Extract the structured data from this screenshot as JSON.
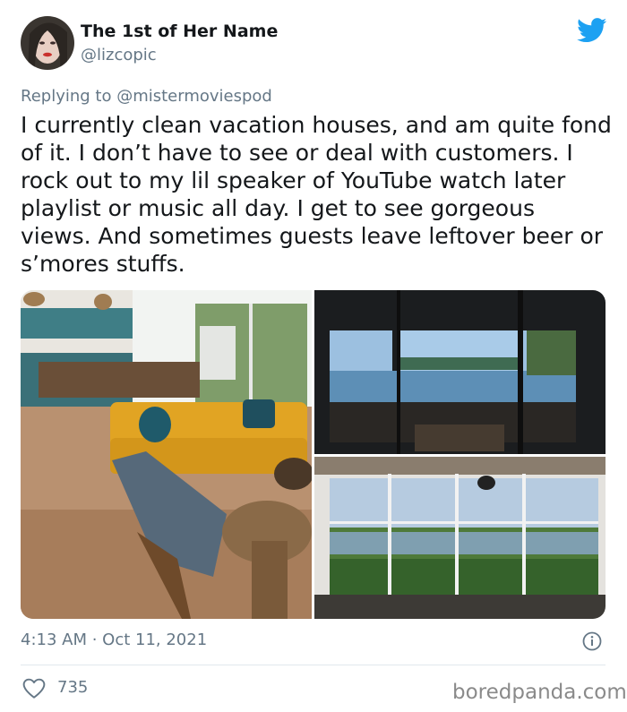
{
  "tweet": {
    "display_name": "The 1st of Her Name",
    "handle": "@lizcopic",
    "replying_to": "Replying to @mistermoviespod",
    "text": "I currently clean vacation houses, and am quite fond of it. I don’t have to see or deal with customers. I rock out to my lil speaker of YouTube watch later playlist or music all day. I get to see gorgeous views. And sometimes guests leave leftover beer or s’mores stuffs.",
    "timestamp": "4:13 AM · Oct 11, 2021",
    "like_count": "735"
  },
  "watermark": "boredpanda.com",
  "icons": {
    "logo": "twitter-bird-icon",
    "info": "info-icon",
    "like": "heart-icon"
  },
  "colors": {
    "twitter_blue": "#1da1f2",
    "secondary_text": "#657786",
    "primary_text": "#14171a"
  }
}
